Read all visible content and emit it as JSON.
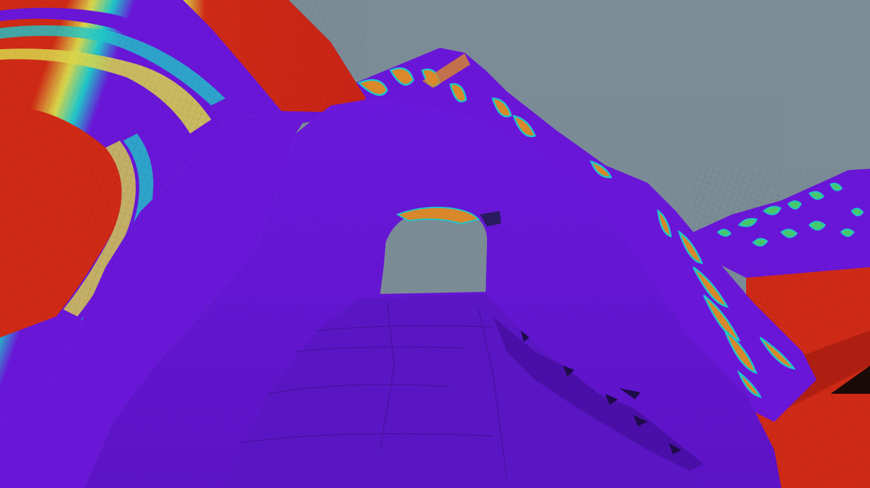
{
  "scene": {
    "kind": "3d-terrain-render",
    "subject": "rock-arch",
    "colormap": "heat-rainbow",
    "wireframe": true,
    "colors": {
      "sky": "#7b8c97",
      "violet": "#6a16d8",
      "violet_dark": "#4a0fa8",
      "blue": "#3b3ad8",
      "cyan": "#1fc7c9",
      "green": "#48c96a",
      "yellow": "#d9d64a",
      "orange": "#d9882a",
      "red": "#cf2a16"
    }
  }
}
